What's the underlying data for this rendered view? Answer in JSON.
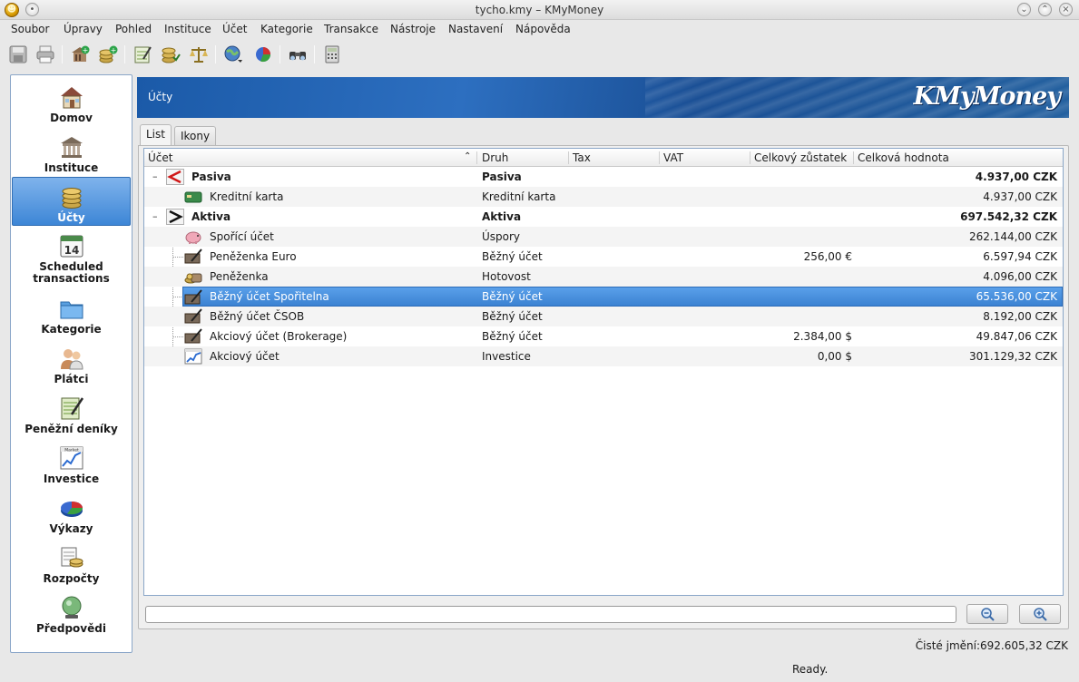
{
  "window": {
    "title": "tycho.kmy – KMyMoney",
    "app_icon_glyph": "☻"
  },
  "menu": [
    {
      "label": "Soubor"
    },
    {
      "label": "Úpravy"
    },
    {
      "label": "Pohled"
    },
    {
      "label": "Instituce"
    },
    {
      "label": "Účet"
    },
    {
      "label": "Kategorie"
    },
    {
      "label": "Transakce"
    },
    {
      "label": "Nástroje"
    },
    {
      "label": "Nastavení"
    },
    {
      "label": "Nápověda"
    }
  ],
  "toolbar_icons": [
    "save-icon",
    "print-icon",
    "new-institution-icon",
    "new-account-icon",
    "ledger-icon",
    "reconcile-icon",
    "scales-icon",
    "online-update-icon",
    "reports-icon",
    "find-icon",
    "calculator-icon"
  ],
  "sidebar": {
    "items": [
      {
        "label": "Domov",
        "icon": "home-icon"
      },
      {
        "label": "Instituce",
        "icon": "institution-icon"
      },
      {
        "label": "Účty",
        "icon": "accounts-icon",
        "selected": true
      },
      {
        "label": "Scheduled transactions",
        "icon": "calendar-icon"
      },
      {
        "label": "Kategorie",
        "icon": "categories-icon"
      },
      {
        "label": "Plátci",
        "icon": "payees-icon"
      },
      {
        "label": "Peněžní deníky",
        "icon": "ledgers-icon"
      },
      {
        "label": "Investice",
        "icon": "investments-icon"
      },
      {
        "label": "Výkazy",
        "icon": "reports-pie-icon"
      },
      {
        "label": "Rozpočty",
        "icon": "budgets-icon"
      },
      {
        "label": "Předpovědi",
        "icon": "forecast-icon"
      }
    ]
  },
  "header": {
    "title": "Účty",
    "logo": "KMyMoney"
  },
  "tabs": [
    {
      "label": "List",
      "active": true
    },
    {
      "label": "Ikony",
      "active": false
    }
  ],
  "table": {
    "columns": [
      "Účet",
      "Druh",
      "Tax",
      "VAT",
      "Celkový zůstatek",
      "Celková hodnota"
    ],
    "groups": [
      {
        "name": "Pasiva",
        "type": "Pasiva",
        "total": "4.937,00 CZK",
        "icon": "liability-arrow-icon",
        "rows": [
          {
            "name": "Kreditní karta",
            "type": "Kreditní karta",
            "balance": "",
            "value": "4.937,00 CZK",
            "icon": "credit-card-icon"
          }
        ]
      },
      {
        "name": "Aktiva",
        "type": "Aktiva",
        "total": "697.542,32 CZK",
        "icon": "asset-arrow-icon",
        "rows": [
          {
            "name": "Spořící účet",
            "type": "Úspory",
            "balance": "",
            "value": "262.144,00 CZK",
            "icon": "piggy-bank-icon"
          },
          {
            "name": "Peněženka Euro",
            "type": "Běžný účet",
            "balance": "256,00 €",
            "value": "6.597,94 CZK",
            "icon": "checkbook-icon"
          },
          {
            "name": "Peněženka",
            "type": "Hotovost",
            "balance": "",
            "value": "4.096,00 CZK",
            "icon": "cash-icon"
          },
          {
            "name": "Běžný účet Spořitelna",
            "type": "Běžný účet",
            "balance": "",
            "value": "65.536,00 CZK",
            "icon": "checkbook-icon",
            "selected": true
          },
          {
            "name": "Běžný účet ČSOB",
            "type": "Běžný účet",
            "balance": "",
            "value": "8.192,00 CZK",
            "icon": "checkbook-icon"
          },
          {
            "name": "Akciový účet (Brokerage)",
            "type": "Běžný účet",
            "balance": "2.384,00 $",
            "value": "49.847,06 CZK",
            "icon": "checkbook-icon"
          },
          {
            "name": "Akciový účet",
            "type": "Investice",
            "balance": "0,00 $",
            "value": "301.129,32 CZK",
            "icon": "market-chart-icon"
          }
        ]
      }
    ]
  },
  "search": {
    "value": "",
    "placeholder": ""
  },
  "status": {
    "net_worth": "Čisté jmění:692.605,32 CZK",
    "message": "Ready."
  },
  "colors": {
    "accent": "#3d86d6",
    "banner": "#1b5aa8",
    "selection": "#4a91df"
  }
}
